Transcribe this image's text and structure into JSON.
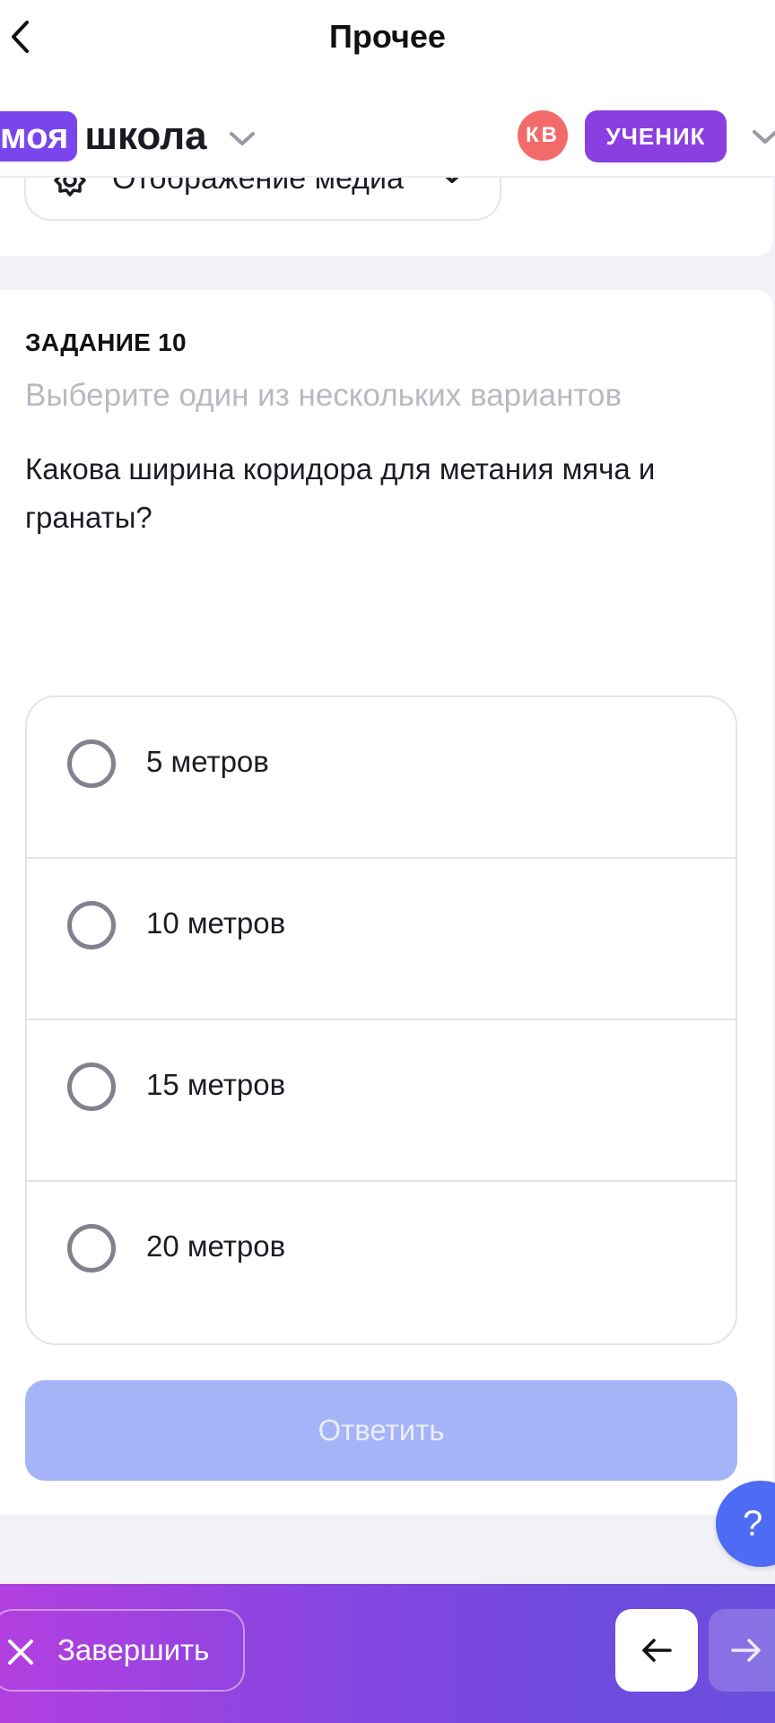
{
  "header": {
    "title": "Прочее",
    "back_icon": "chevron-left-icon"
  },
  "brand": {
    "part1": "моя",
    "part2": "школа",
    "accent_color": "#7b45ee"
  },
  "user": {
    "initials": "КВ",
    "avatar_color": "#f36a6a",
    "role": "УЧЕНИК",
    "role_color": "#8a3fe0"
  },
  "media_toggle": {
    "label": "Отображение медиа",
    "icon": "gear-icon"
  },
  "task": {
    "number_label": "ЗАДАНИЕ 10",
    "hint": "Выберите один из нескольких вариантов",
    "question": "Какова ширина коридора для метания мяча и гранаты?",
    "options": [
      {
        "label": "5 метров",
        "selected": false
      },
      {
        "label": "10 метров",
        "selected": false
      },
      {
        "label": "15 метров",
        "selected": false
      },
      {
        "label": "20 метров",
        "selected": false
      }
    ],
    "submit_label": "Ответить"
  },
  "help": {
    "label": "?"
  },
  "footer": {
    "finish_label": "Завершить",
    "finish_icon": "close-icon",
    "prev_icon": "arrow-left-icon",
    "next_icon": "arrow-right-icon"
  }
}
